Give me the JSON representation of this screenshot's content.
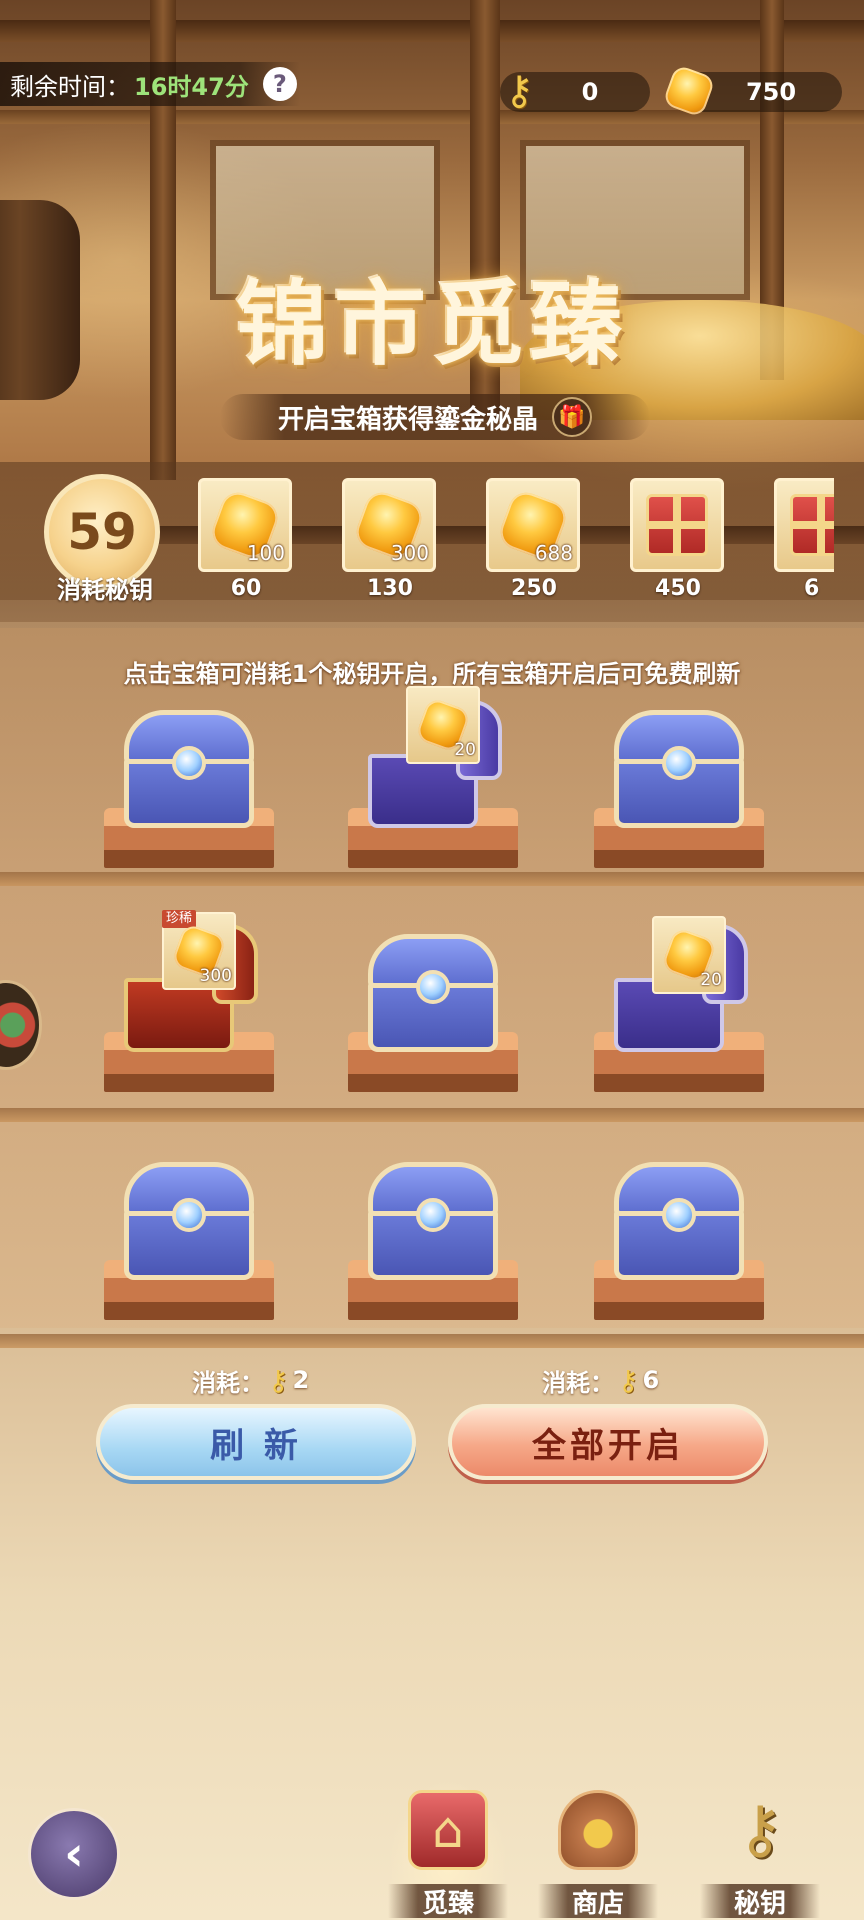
{
  "header": {
    "timer_label": "剩余时间：",
    "timer_value": "16时47分",
    "help_glyph": "?",
    "keys_count": "0",
    "gems_count": "750"
  },
  "banner": {
    "title": "锦市觅臻",
    "subtitle": "开启宝箱获得鎏金秘晶"
  },
  "progress": {
    "keys_spent": "59",
    "keys_spent_label": "消耗秘钥",
    "milestones": [
      {
        "reward": "100",
        "cost": "60",
        "kind": "gem"
      },
      {
        "reward": "300",
        "cost": "130",
        "kind": "gem"
      },
      {
        "reward": "688",
        "cost": "250",
        "kind": "gem"
      },
      {
        "reward": "",
        "cost": "450",
        "kind": "gift"
      },
      {
        "reward": "",
        "cost": "6",
        "kind": "gift"
      }
    ]
  },
  "board": {
    "hint": "点击宝箱可消耗1个秘钥开启，所有宝箱开启后可免费刷新",
    "chests": [
      {
        "state": "closed"
      },
      {
        "state": "opened",
        "reward": "20"
      },
      {
        "state": "closed"
      },
      {
        "state": "opened",
        "rare": true,
        "tag": "珍稀",
        "reward": "300"
      },
      {
        "state": "closed"
      },
      {
        "state": "opened",
        "reward": "20"
      },
      {
        "state": "closed"
      },
      {
        "state": "closed"
      },
      {
        "state": "closed"
      }
    ]
  },
  "actions": {
    "cost_label": "消耗：",
    "refresh_cost": "2",
    "refresh_label": "刷 新",
    "openall_cost": "6",
    "openall_label": "全部开启"
  },
  "nav": {
    "back_glyph": "‹",
    "tabs": [
      {
        "label": "觅臻",
        "icon": "treasure-chest-icon",
        "active": true
      },
      {
        "label": "商店",
        "icon": "coin-bag-icon",
        "active": false
      },
      {
        "label": "秘钥",
        "icon": "key-icon",
        "active": false
      }
    ]
  },
  "colors": {
    "timer_green": "#9ee37a",
    "gem_gold": "#ffc940",
    "refresh_blue": "#a8d8f4",
    "openall_red": "#f6a888"
  }
}
